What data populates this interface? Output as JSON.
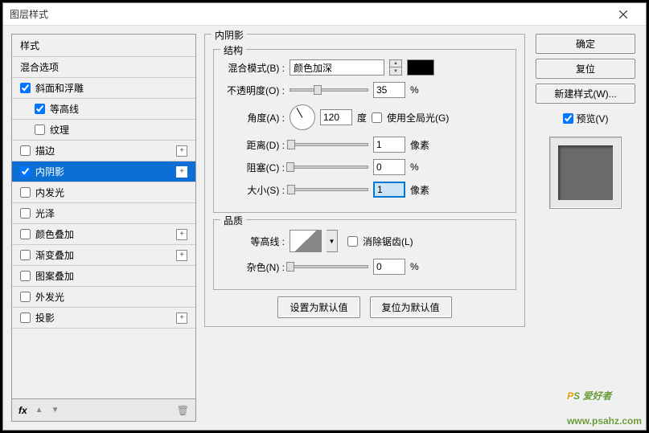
{
  "window": {
    "title": "图层样式"
  },
  "sidebar": {
    "header": "样式",
    "blending_options": "混合选项",
    "items": [
      {
        "label": "斜面和浮雕",
        "checked": true,
        "plus": false,
        "indent": false
      },
      {
        "label": "等高线",
        "checked": true,
        "plus": false,
        "indent": true
      },
      {
        "label": "纹理",
        "checked": false,
        "plus": false,
        "indent": true
      },
      {
        "label": "描边",
        "checked": false,
        "plus": true,
        "indent": false
      },
      {
        "label": "内阴影",
        "checked": true,
        "plus": true,
        "indent": false,
        "selected": true
      },
      {
        "label": "内发光",
        "checked": false,
        "plus": false,
        "indent": false
      },
      {
        "label": "光泽",
        "checked": false,
        "plus": false,
        "indent": false
      },
      {
        "label": "颜色叠加",
        "checked": false,
        "plus": true,
        "indent": false
      },
      {
        "label": "渐变叠加",
        "checked": false,
        "plus": true,
        "indent": false
      },
      {
        "label": "图案叠加",
        "checked": false,
        "plus": false,
        "indent": false
      },
      {
        "label": "外发光",
        "checked": false,
        "plus": false,
        "indent": false
      },
      {
        "label": "投影",
        "checked": false,
        "plus": true,
        "indent": false
      }
    ],
    "footer_fx": "fx"
  },
  "panel": {
    "title": "内阴影",
    "structure": {
      "group": "结构",
      "blend_mode_label": "混合模式(B) :",
      "blend_mode_value": "颜色加深",
      "color": "#000000",
      "opacity_label": "不透明度(O) :",
      "opacity_value": "35",
      "opacity_unit": "%",
      "angle_label": "角度(A) :",
      "angle_value": "120",
      "angle_unit": "度",
      "global_light": "使用全局光(G)",
      "distance_label": "距离(D) :",
      "distance_value": "1",
      "distance_unit": "像素",
      "choke_label": "阻塞(C) :",
      "choke_value": "0",
      "choke_unit": "%",
      "size_label": "大小(S) :",
      "size_value": "1",
      "size_unit": "像素"
    },
    "quality": {
      "group": "品质",
      "contour_label": "等高线 :",
      "antialias": "消除锯齿(L)",
      "noise_label": "杂色(N) :",
      "noise_value": "0",
      "noise_unit": "%"
    },
    "make_default": "设置为默认值",
    "reset_default": "复位为默认值"
  },
  "right": {
    "ok": "确定",
    "cancel": "复位",
    "new_style": "新建样式(W)...",
    "preview": "预览(V)"
  },
  "watermark": {
    "p": "P",
    "s": "S",
    "text": " 爱好者",
    "url": "www.psahz.com"
  }
}
